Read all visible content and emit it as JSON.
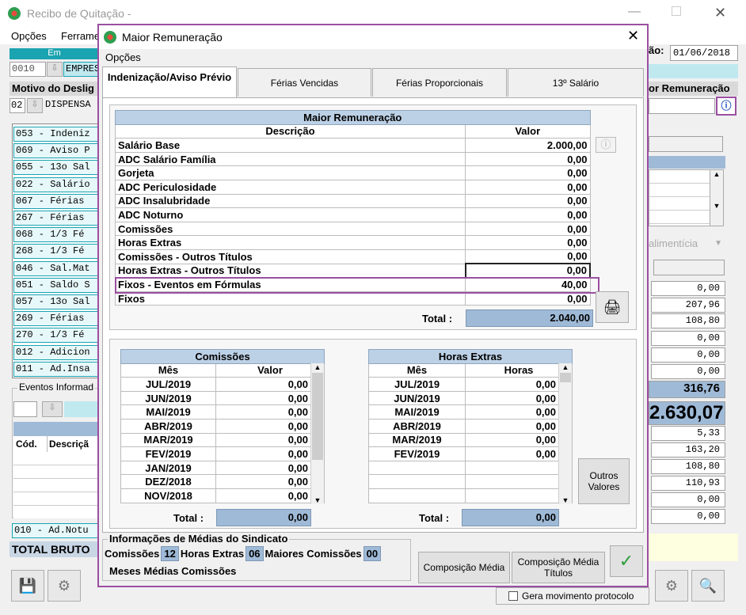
{
  "bg": {
    "title": "Recibo de Quitação -",
    "menu": [
      "Opções",
      "Ferrame"
    ],
    "emp_header": "Em",
    "emp_code": "0010",
    "emp_name": "EMPRES",
    "date_label": "ão:",
    "date_value": "01/06/2018",
    "motivo_label": "Motivo do Deslig",
    "motivo_code": "02",
    "motivo_text": "DISPENSA",
    "maior_rem_label": "or Remuneração",
    "list": [
      "053 - Indeniz",
      "069 - Aviso P",
      "055 - 13o Sal",
      "022 - Salário",
      "067 - Férias",
      "267 - Férias",
      "068 - 1/3 Fé",
      "268 - 1/3 Fé",
      "046 - Sal.Mat",
      "051 - Saldo S",
      "057 - 13o Sal",
      "269 - Férias",
      "270 - 1/3 Fé",
      "012 - Adicion",
      "011 - Ad.Insa"
    ],
    "eventos_label": "Eventos Informad",
    "cod_col": "Cód.",
    "desc_col": "Descriçã",
    "list_last": "010 - Ad.Notu",
    "total_bruto": "TOTAL BRUTO",
    "alim": "alimentícia",
    "values": [
      "0,00",
      "207,96",
      "108,80",
      "0,00",
      "0,00",
      "0,00",
      "316,76",
      "2.630,07",
      "5,33",
      "163,20",
      "108,80",
      "110,93",
      "0,00",
      "0,00"
    ],
    "gera": "Gera movimento protocolo"
  },
  "modal": {
    "title": "Maior Remuneração",
    "menu": "Opções",
    "tabs": [
      {
        "label": "Indenização/Aviso Prévio"
      },
      {
        "label": "Férias Vencidas"
      },
      {
        "label": "Férias Proporcionais"
      },
      {
        "label": "13º Salário"
      }
    ],
    "main": {
      "caption": "Maior Remuneração",
      "col_desc": "Descrição",
      "col_valor": "Valor",
      "rows": [
        {
          "d": "Salário Base",
          "v": "2.000,00"
        },
        {
          "d": "ADC Salário Família",
          "v": "0,00"
        },
        {
          "d": "Gorjeta",
          "v": "0,00"
        },
        {
          "d": "ADC Periculosidade",
          "v": "0,00"
        },
        {
          "d": "ADC Insalubridade",
          "v": "0,00"
        },
        {
          "d": "ADC Noturno",
          "v": "0,00"
        },
        {
          "d": "Comissões",
          "v": "0,00"
        },
        {
          "d": "Horas Extras",
          "v": "0,00"
        },
        {
          "d": "Comissões - Outros Títulos",
          "v": "0,00"
        },
        {
          "d": "Horas Extras - Outros Títulos",
          "v": "0,00"
        },
        {
          "d": "Fixos - Eventos em Fórmulas",
          "v": "40,00"
        },
        {
          "d": "Fixos",
          "v": "0,00"
        }
      ],
      "total_label": "Total :",
      "total": "2.040,00"
    },
    "comissoes": {
      "caption": "Comissões",
      "col_mes": "Mês",
      "col_valor": "Valor",
      "rows": [
        {
          "m": "JUL/2019",
          "v": "0,00"
        },
        {
          "m": "JUN/2019",
          "v": "0,00"
        },
        {
          "m": "MAI/2019",
          "v": "0,00"
        },
        {
          "m": "ABR/2019",
          "v": "0,00"
        },
        {
          "m": "MAR/2019",
          "v": "0,00"
        },
        {
          "m": "FEV/2019",
          "v": "0,00"
        },
        {
          "m": "JAN/2019",
          "v": "0,00"
        },
        {
          "m": "DEZ/2018",
          "v": "0,00"
        },
        {
          "m": "NOV/2018",
          "v": "0,00"
        }
      ],
      "total_label": "Total :",
      "total": "0,00"
    },
    "horas": {
      "caption": "Horas Extras",
      "col_mes": "Mês",
      "col_horas": "Horas",
      "rows": [
        {
          "m": "JUL/2019",
          "v": "0,00"
        },
        {
          "m": "JUN/2019",
          "v": "0,00"
        },
        {
          "m": "MAI/2019",
          "v": "0,00"
        },
        {
          "m": "ABR/2019",
          "v": "0,00"
        },
        {
          "m": "MAR/2019",
          "v": "0,00"
        },
        {
          "m": "FEV/2019",
          "v": "0,00"
        },
        {
          "m": "",
          "v": ""
        },
        {
          "m": "",
          "v": ""
        },
        {
          "m": "",
          "v": ""
        }
      ],
      "total_label": "Total :",
      "total": "0,00"
    },
    "outros_valores": "Outros Valores",
    "sindicato": {
      "legend": "Informações de Médias do Sindicato",
      "comissoes_label": "Comissões",
      "comissoes": "12",
      "horas_label": "Horas Extras",
      "horas": "06",
      "maiores_label": "Maiores Comissões",
      "maiores": "00",
      "meses_label": "Meses Médias Comissões"
    },
    "btn_comp_media": "Composição Média",
    "btn_comp_titulos": "Composição Média Títulos"
  }
}
